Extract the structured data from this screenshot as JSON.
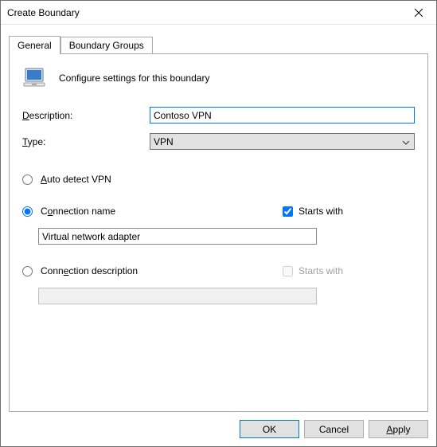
{
  "title": "Create Boundary",
  "tabs": {
    "general": "General",
    "groups": "Boundary Groups"
  },
  "header_text": "Configure settings for this boundary",
  "labels": {
    "description": "Description:",
    "type": "Type:",
    "auto_detect": "Auto detect VPN",
    "conn_name": "Connection name",
    "conn_desc": "Connection description",
    "starts_with": "Starts with"
  },
  "values": {
    "description": "Contoso VPN",
    "type": "VPN",
    "conn_name_input": "Virtual network adapter",
    "conn_desc_input": ""
  },
  "buttons": {
    "ok": "OK",
    "cancel": "Cancel",
    "apply": "Apply"
  }
}
